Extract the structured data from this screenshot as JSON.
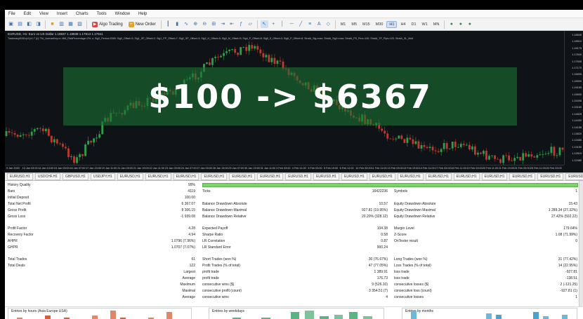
{
  "menu": [
    "File",
    "Edit",
    "View",
    "Insert",
    "Charts",
    "Tools",
    "Window",
    "Help"
  ],
  "toolbar": {
    "algo_trading": "Algo Trading",
    "new_order": "New Order",
    "timeframes": [
      "M1",
      "M5",
      "M15",
      "M30",
      "H1",
      "H4",
      "D1",
      "W1",
      "MN"
    ],
    "active_timeframe": "H1"
  },
  "chart": {
    "title": "EURUSD, H1: Euro vs US Dollar  1.18837 1.18838 1.17913 1.17941",
    "params": "TradeeasyEAEx(v1)x1.7 [v]: TM_LicenseKey=n; MM_RiskPercentage=2%; n; Sig0_Period=5365; Sig0_Offset=3; Sig1_SP_Offset=2; Sig1_PP_Offset=7; Sig2_SP_Offset=3; Sig2_H_Offset=5; Sig3_M_Offset=5; Sig4_P_Offset=8; Sig5_S_Offset=3; Sig6_P_Offset=8; StratA_Sig=max; StratA_Sig2=max; StratA_PS_Pmx=100; StratA_TP_Pips=120; StratA_SL_Mult",
    "overlay_text": "$100 -> $6367",
    "up_color": "#2f9e4b",
    "down_color": "#c0392b",
    "prices": [
      "1.18845",
      "1.18510",
      "1.18175",
      "1.17840",
      "1.17505",
      "1.17170",
      "1.16835",
      "1.16500",
      "1.16165",
      "1.15830",
      "1.15495",
      "1.15160",
      "1.14825",
      "1.14490",
      "1.14155",
      "1.13820",
      "1.13485",
      "1.13150",
      "1.12815",
      "1.12480"
    ],
    "times": [
      "9 Jan 2020",
      "13 Jan 03:00",
      "14 Jan 13:00",
      "15 Jan 03:00",
      "16 Jan 07:00",
      "17 Jan 23:00",
      "19 Jan 11:00",
      "21 Jan 03:00",
      "21 Jan 19:00",
      "22 Jan 11:00",
      "23 Jan 03:00",
      "24 Jan 07:00",
      "27 Jan 03:00",
      "28 Jan 15:00",
      "29 Jan 07:00",
      "30 Jan 23:00",
      "31 Jan 11:00",
      "3 Feb 03:00",
      "4 Feb 11:00",
      "5 Feb 03:00",
      "5 Feb 19:00",
      "6 Feb 11:00",
      "10 Feb 03:00",
      "11 Feb 11:00",
      "13 Feb 03:00",
      "13 Feb 19:00",
      "14 Feb 11:00",
      "17 Feb 03:00",
      "18 Feb 11:00",
      "19 Feb 03:00",
      "20 Feb 11:00",
      "21 Feb 19:00",
      "24 Feb 03:00",
      "25 Feb 11:00",
      "26 Feb 03:00"
    ]
  },
  "symbol_tabs": [
    "EURUSD,H1",
    "USDCHF,H1",
    "GBPUSD,H1",
    "USDJPY,H1",
    "EURUSD,H1",
    "EURUSD,H1",
    "EURUSD,H1",
    "EURUSD,H1",
    "EURUSD,H1",
    "EURUSD,H1",
    "EURUSD,H1",
    "EURUSD,H1",
    "EURUSD,H1",
    "EURUSD,H1",
    "EURUSD,H1",
    "EURUSD,H1",
    "EURUSD,H1",
    "EURUSD,H1",
    "EURUSD,H1",
    "EURUSD,H1",
    "EURUSD,H1",
    "EURUSD,H1"
  ],
  "report": {
    "history_quality_label": "History Quality",
    "history_quality_value": "99%",
    "history_quality_fraction": 0.99,
    "bars_label": "Bars",
    "bars_value": "4119",
    "ticks_label": "Ticks",
    "ticks_value": "16422236",
    "symbols_label": "Symbols",
    "symbols_value": "1",
    "initial_deposit_label": "Initial Deposit",
    "initial_deposit_value": "100.00",
    "net_profit_label": "Total Net Profit",
    "net_profit_value": "6 367.07",
    "bal_dd_abs_label": "Balance Drawdown Absolute",
    "bal_dd_abs_value": "10.57",
    "eq_dd_abs_label": "Equity Drawdown Absolute",
    "eq_dd_abs_value": "15.43",
    "gross_profit_label": "Gross Profit",
    "gross_profit_value": "8 306.15",
    "bal_dd_max_label": "Balance Drawdown Maximal",
    "bal_dd_max_value": "927.81 (19.95%)",
    "eq_dd_max_label": "Equity Drawdown Maximal",
    "eq_dd_max_value": "1 289.34 (27.32%)",
    "gross_loss_label": "Gross Loss",
    "gross_loss_value": "-1 939.08",
    "bal_dd_rel_label": "Balance Drawdown Relative",
    "bal_dd_rel_value": "20.20% (328.12)",
    "eq_dd_rel_label": "Equity Drawdown Relative",
    "eq_dd_rel_value": "27.42% (502.22)",
    "profit_factor_label": "Profit Factor",
    "profit_factor_value": "4.28",
    "expected_payoff_label": "Expected Payoff",
    "expected_payoff_value": "104.38",
    "margin_level_label": "Margin Level",
    "margin_level_value": "179.64%",
    "recovery_factor_label": "Recovery Factor",
    "recovery_factor_value": "4.94",
    "sharpe_label": "Sharpe Ratio",
    "sharpe_value": "0.58",
    "zscore_label": "Z-Score",
    "zscore_value": "1.08 (71.99%)",
    "ahpr_label": "AHPR",
    "ahpr_value": "1.0796 (7.96%)",
    "lr_corr_label": "LR Correlation",
    "lr_corr_value": "0.87",
    "ontester_label": "OnTester result",
    "ontester_value": "0",
    "ghpr_label": "GHPR",
    "ghpr_value": "1.0707 (7.07%)",
    "lr_err_label": "LR Standard Error",
    "lr_err_value": "900.24",
    "total_trades_label": "Total Trades",
    "total_trades_value": "61",
    "short_trades_label": "Short Trades (won %)",
    "short_trades_value": "30 (76.67%)",
    "long_trades_label": "Long Trades (won %)",
    "long_trades_value": "31 (77.42%)",
    "total_deals_label": "Total Deals",
    "total_deals_value": "122",
    "profit_trades_label": "Profit Trades (% of total)",
    "profit_trades_value": "47 (77.05%)",
    "loss_trades_label": "Loss Trades (% of total)",
    "loss_trades_value": "14 (22.95%)",
    "largest_label": "Largest",
    "largest_profit_label": "profit trade",
    "largest_profit_value": "1 389.91",
    "largest_loss_label": "loss trade",
    "largest_loss_value": "-927.81",
    "average_label": "Average",
    "average_profit_label": "profit trade",
    "average_profit_value": "176.73",
    "average_loss_label": "loss trade",
    "average_loss_value": "-138.51",
    "maximum_label": "Maximum",
    "max_cons_wins_label": "consecutive wins ($)",
    "max_cons_wins_value": "9 (526.10)",
    "max_cons_losses_label": "consecutive losses ($)",
    "max_cons_losses_value": "2 (-121.25)",
    "maximal_label": "Maximal",
    "maximal_profit_label": "consecutive profit (count)",
    "maximal_profit_value": "3 354.51 (7)",
    "maximal_loss_label": "consecutive loss (count)",
    "maximal_loss_value": "-927.81 (1)",
    "average2_label": "Average",
    "avg_cons_wins_label": "consecutive wins",
    "avg_cons_wins_value": "4",
    "avg_cons_losses_label": "consecutive losses",
    "avg_cons_losses_value": "1"
  },
  "histograms": {
    "hours_title": "Entries by hours (Asia Europe USA)",
    "weekdays_title": "Entries by weekdays",
    "months_title": "Entries by months",
    "hours_values": [
      1,
      0,
      0,
      2,
      0,
      1,
      0,
      0,
      2,
      0,
      5,
      1,
      0,
      0,
      1,
      0,
      4,
      0
    ],
    "weekdays_values": [
      0,
      1,
      0,
      1,
      0,
      5,
      6,
      2,
      3,
      5,
      2
    ],
    "months_values": [
      6,
      0,
      0,
      0,
      0,
      0,
      0,
      0,
      4,
      3,
      0,
      0,
      0,
      5,
      2,
      0,
      3
    ]
  }
}
